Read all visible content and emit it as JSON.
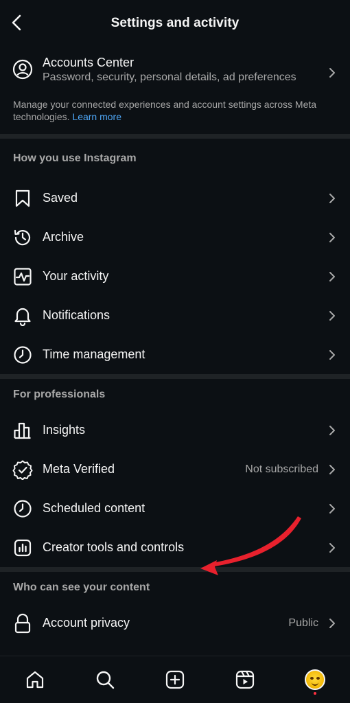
{
  "header": {
    "title": "Settings and activity"
  },
  "accounts_center": {
    "name": "Accounts Center",
    "subtitle": "Password, security, personal details, ad preferences"
  },
  "manage_note": {
    "text": "Manage your connected experiences and account settings across Meta technologies.",
    "link": "Learn more"
  },
  "sections": [
    {
      "title": "How you use Instagram",
      "items": [
        {
          "label": "Saved",
          "icon": "bookmark-icon"
        },
        {
          "label": "Archive",
          "icon": "archive-icon"
        },
        {
          "label": "Your activity",
          "icon": "activity-icon"
        },
        {
          "label": "Notifications",
          "icon": "bell-icon"
        },
        {
          "label": "Time management",
          "icon": "clock-icon"
        }
      ]
    },
    {
      "title": "For professionals",
      "items": [
        {
          "label": "Insights",
          "icon": "bar-chart-icon"
        },
        {
          "label": "Meta Verified",
          "icon": "verified-badge-icon",
          "value": "Not subscribed"
        },
        {
          "label": "Scheduled content",
          "icon": "clock-icon"
        },
        {
          "label": "Creator tools and controls",
          "icon": "creator-tools-icon"
        }
      ]
    },
    {
      "title": "Who can see your content",
      "items": [
        {
          "label": "Account privacy",
          "icon": "lock-icon",
          "value": "Public"
        }
      ]
    }
  ],
  "bottom_nav": [
    "home-icon",
    "search-icon",
    "create-icon",
    "reels-icon",
    "profile-avatar"
  ],
  "colors": {
    "background": "#0c1014",
    "divider": "#1f2326",
    "link": "#4ea6f5",
    "annotation_arrow": "#e8212d",
    "notification_dot": "#ff3040"
  }
}
